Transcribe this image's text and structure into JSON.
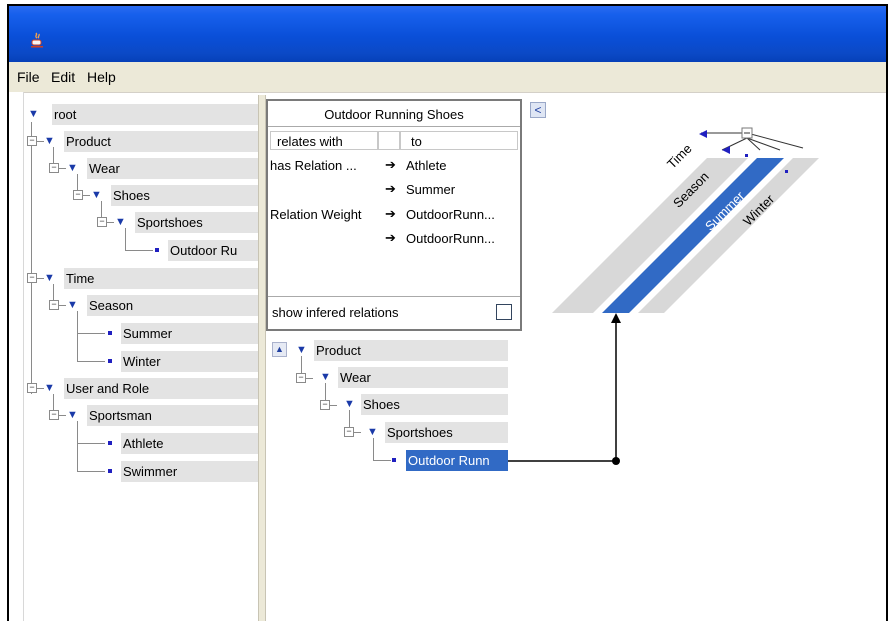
{
  "menu": [
    "File",
    "Edit",
    "Help"
  ],
  "tree": {
    "items": [
      {
        "label": "root"
      },
      {
        "label": "Product"
      },
      {
        "label": "Wear"
      },
      {
        "label": "Shoes"
      },
      {
        "label": "Sportshoes"
      },
      {
        "label": "Outdoor Ru"
      },
      {
        "label": "Time"
      },
      {
        "label": "Season"
      },
      {
        "label": "Summer"
      },
      {
        "label": "Winter"
      },
      {
        "label": "User and Role"
      },
      {
        "label": "Sportsman"
      },
      {
        "label": "Athlete"
      },
      {
        "label": "Swimmer"
      }
    ]
  },
  "relations": {
    "title": "Outdoor Running Shoes",
    "col_relates": "relates with",
    "col_to": "to",
    "rows": [
      {
        "relation": "has Relation ...",
        "target": "Athlete"
      },
      {
        "relation": "",
        "target": "Summer"
      },
      {
        "relation": "Relation Weight",
        "target": "OutdoorRunn..."
      },
      {
        "relation": "",
        "target": "OutdoorRunn..."
      }
    ],
    "show_inferred_label": "show infered relations",
    "show_inferred_checked": false
  },
  "graph_tree": {
    "items": [
      {
        "label": "Product"
      },
      {
        "label": "Wear"
      },
      {
        "label": "Shoes"
      },
      {
        "label": "Sportshoes"
      },
      {
        "label": "Outdoor Runn"
      }
    ]
  },
  "rotated_labels": [
    "Time",
    "Season",
    "Summer",
    "Winter"
  ],
  "colors": {
    "selection": "#316ac5",
    "titlebar": "#0a4fd8",
    "node_bg": "#e3e3e3"
  }
}
